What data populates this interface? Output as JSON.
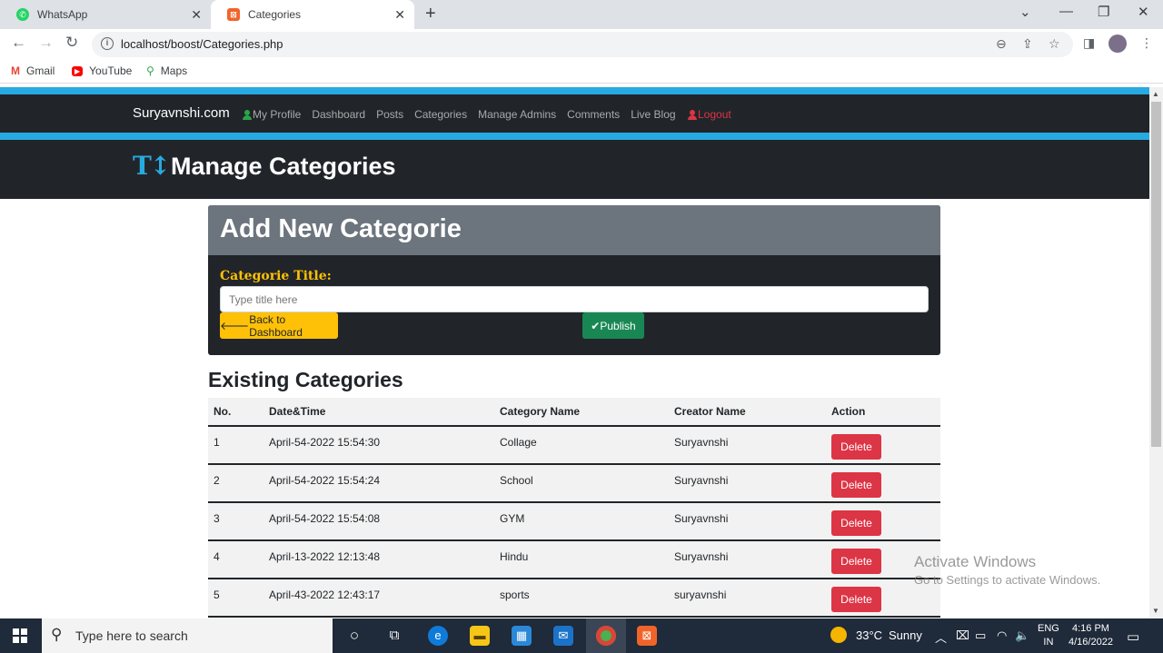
{
  "browser": {
    "tabs": [
      {
        "title": "WhatsApp",
        "icon": "whatsapp-icon",
        "active": false
      },
      {
        "title": "Categories",
        "icon": "xampp-icon",
        "active": true
      }
    ],
    "url": "localhost/boost/Categories.php",
    "bookmarks": [
      {
        "label": "Gmail",
        "icon": "gmail-icon"
      },
      {
        "label": "YouTube",
        "icon": "youtube-icon"
      },
      {
        "label": "Maps",
        "icon": "maps-icon"
      }
    ]
  },
  "navbar": {
    "brand": "Suryavnshi.com",
    "links": [
      "My Profile",
      "Dashboard",
      "Posts",
      "Categories",
      "Manage Admins",
      "Comments",
      "Live Blog"
    ],
    "logout": "Logout"
  },
  "header": {
    "title": "Manage Categories",
    "icon": "text-height-icon",
    "icon_glyph": "T↕"
  },
  "form": {
    "heading": "Add New Categorie",
    "label": "Categorie Title:",
    "placeholder": "Type title here",
    "back_button": "Back to Dashboard",
    "publish_button": "Publish"
  },
  "existing": {
    "heading": "Existing Categories",
    "columns": [
      "No.",
      "Date&Time",
      "Category Name",
      "Creator Name",
      "Action"
    ],
    "rows": [
      {
        "no": "1",
        "datetime": "April-54-2022 15:54:30",
        "name": "Collage",
        "creator": "Suryavnshi",
        "action": "Delete"
      },
      {
        "no": "2",
        "datetime": "April-54-2022 15:54:24",
        "name": "School",
        "creator": "Suryavnshi",
        "action": "Delete"
      },
      {
        "no": "3",
        "datetime": "April-54-2022 15:54:08",
        "name": "GYM",
        "creator": "Suryavnshi",
        "action": "Delete"
      },
      {
        "no": "4",
        "datetime": "April-13-2022 12:13:48",
        "name": "Hindu",
        "creator": "Suryavnshi",
        "action": "Delete"
      },
      {
        "no": "5",
        "datetime": "April-43-2022 12:43:17",
        "name": "sports",
        "creator": "suryavnshi",
        "action": "Delete"
      }
    ]
  },
  "watermark": {
    "line1": "Activate Windows",
    "line2": "Go to Settings to activate Windows."
  },
  "taskbar": {
    "search_placeholder": "Type here to search",
    "weather_temp": "33°C",
    "weather_text": "Sunny",
    "lang_top": "ENG",
    "lang_bottom": "IN",
    "time": "4:16 PM",
    "date": "4/16/2022"
  },
  "colors": {
    "accent_blue": "#27aae1",
    "dark": "#212529",
    "warning": "#ffc107",
    "success": "#198754",
    "danger": "#dc3545",
    "secondary": "#6c757d"
  }
}
